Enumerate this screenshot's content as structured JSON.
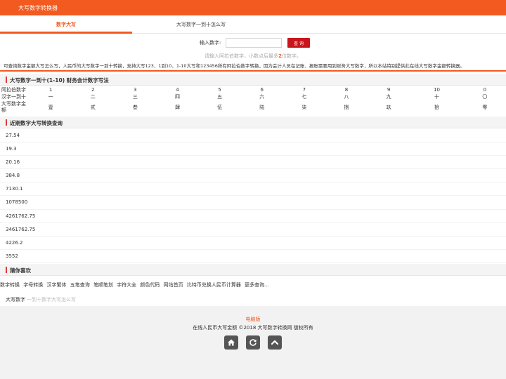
{
  "app": {
    "title": "大写数字转换器"
  },
  "tabs": [
    {
      "label": "数字大写",
      "active": true
    },
    {
      "label": "大写数字一到十怎么写",
      "active": false
    }
  ],
  "form": {
    "label": "输入数字:",
    "value": "",
    "placeholder": "",
    "button_label": "查 询"
  },
  "hint": {
    "before": "请输入阿拉伯数字，小数点后最多",
    "bold": "2",
    "after": "位数字。"
  },
  "intro": "可查询数字金额大写怎么写，人民币的大写数字一到十转换，支持大写123、1到10、1-10大写和123456所有阿拉伯数字转换，因为会计人员在记账、报账需要用到财务大写数字，所以本站特别提供此在线大写数字金额转换器。",
  "section1": {
    "title": "大写数字一到十(1-10) 财务会计数字写法"
  },
  "numtable": {
    "rows": [
      {
        "label": "阿拉伯数字",
        "cells": [
          "1",
          "2",
          "3",
          "4",
          "5",
          "6",
          "7",
          "8",
          "9",
          "10",
          "0"
        ]
      },
      {
        "label": "汉字一到十",
        "cells": [
          "一",
          "二",
          "三",
          "四",
          "五",
          "六",
          "七",
          "八",
          "九",
          "十",
          "〇"
        ]
      },
      {
        "label": "大写数字金额",
        "cells": [
          "壹",
          "贰",
          "叁",
          "肆",
          "伍",
          "陆",
          "柒",
          "捌",
          "玖",
          "拾",
          "零"
        ]
      }
    ]
  },
  "section2": {
    "title": "近期数字大写转换查询"
  },
  "history": [
    "27.54",
    "19.3",
    "20.16",
    "384.8",
    "7130.1",
    "1078500",
    "4261762.75",
    "3461762.75",
    "4226.2",
    "3552"
  ],
  "section3": {
    "title": "猜你喜欢"
  },
  "links": [
    "数字转换",
    "字母转换",
    "汉字繁体",
    "五笔查询",
    "笔顺笔划",
    "字符大全",
    "颜色代码",
    "网站首页",
    "比特币兑换人民币计算器",
    "更多查询..."
  ],
  "crumbs": {
    "home": "大写数字",
    "current": "一到十数字大写怎么写"
  },
  "footer": {
    "pc_label": "电脑版",
    "copyright": "在线人民币大写金额 ©2018 大写数字转换网 版权所有"
  },
  "colors": {
    "brand": "#f25a1f",
    "button": "#c8161d",
    "section_marker": "#e53935"
  },
  "icons": [
    "home-icon",
    "refresh-icon",
    "back-to-top-icon"
  ]
}
